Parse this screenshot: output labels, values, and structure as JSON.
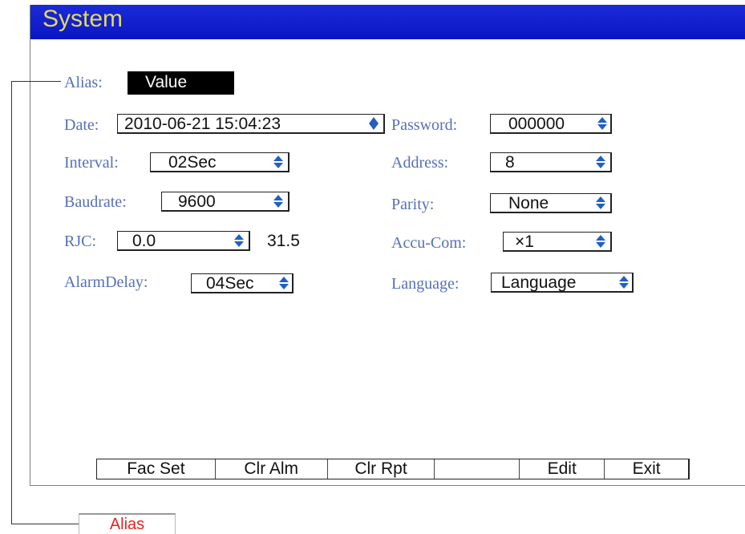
{
  "title": "System",
  "alias": {
    "label": "Alias:",
    "value": "Value"
  },
  "fields": {
    "date": {
      "label": "Date:",
      "value": "2010-06-21 15:04:23"
    },
    "password": {
      "label": "Password:",
      "value": "000000"
    },
    "interval": {
      "label": "Interval:",
      "value": "02Sec"
    },
    "address": {
      "label": "Address:",
      "value": "8"
    },
    "baudrate": {
      "label": "Baudrate:",
      "value": "9600"
    },
    "parity": {
      "label": "Parity:",
      "value": "None"
    },
    "rjc": {
      "label": "RJC:",
      "value": "0.0",
      "reading": "31.5"
    },
    "accu_com": {
      "label": "Accu-Com:",
      "value": "×1"
    },
    "alarm_delay": {
      "label": "AlarmDelay:",
      "value": "04Sec"
    },
    "language": {
      "label": "Language:",
      "value": "Language"
    }
  },
  "toolbar": [
    "Fac Set",
    "Clr Alm",
    "Clr Rpt",
    "",
    "Edit",
    "Exit"
  ],
  "bottom_tab": "Alias",
  "colors": {
    "title_bg": "#0a16c4",
    "title_text": "#e3d95a",
    "label": "#5570b8",
    "spinner": "#2060c0",
    "alias_tab_text": "#e8231c"
  }
}
